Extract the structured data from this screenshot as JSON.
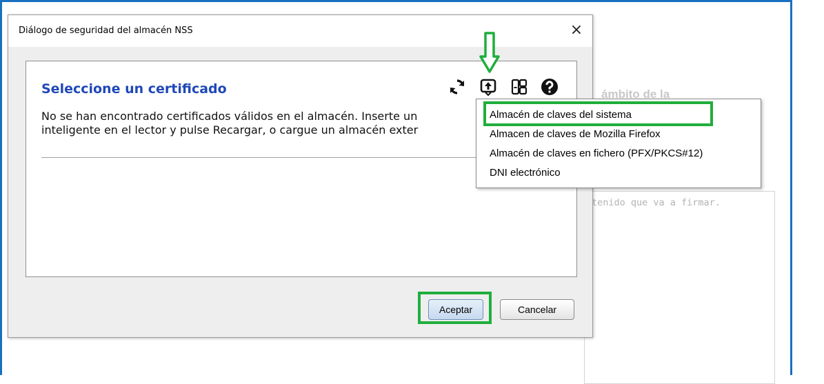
{
  "background": {
    "partial_label": "ámbito de la",
    "textarea_placeholder": "tenido que va a firmar."
  },
  "dialog": {
    "title": "Diálogo de seguridad del almacén NSS",
    "close_symbol": "×",
    "heading": "Seleccione un certificado",
    "message_line1": "No se han encontrado certificados válidos en el almacén. Inserte un",
    "message_line2": "inteligente en el lector y pulse Recargar, o cargue un almacén exter",
    "toolbar_icons": [
      "refresh-icon",
      "open-store-icon",
      "certificate-details-icon",
      "help-icon"
    ],
    "buttons": {
      "accept": "Aceptar",
      "cancel": "Cancelar"
    }
  },
  "store_menu": {
    "items": [
      "Almacén de claves del sistema",
      "Almacen de claves de Mozilla Firefox",
      "Almacén de claves en fichero (PFX/PKCS#12)",
      "DNI electrónico"
    ]
  },
  "colors": {
    "frame": "#1a6fc0",
    "heading": "#1f48b8",
    "highlight": "#1fae3c"
  }
}
